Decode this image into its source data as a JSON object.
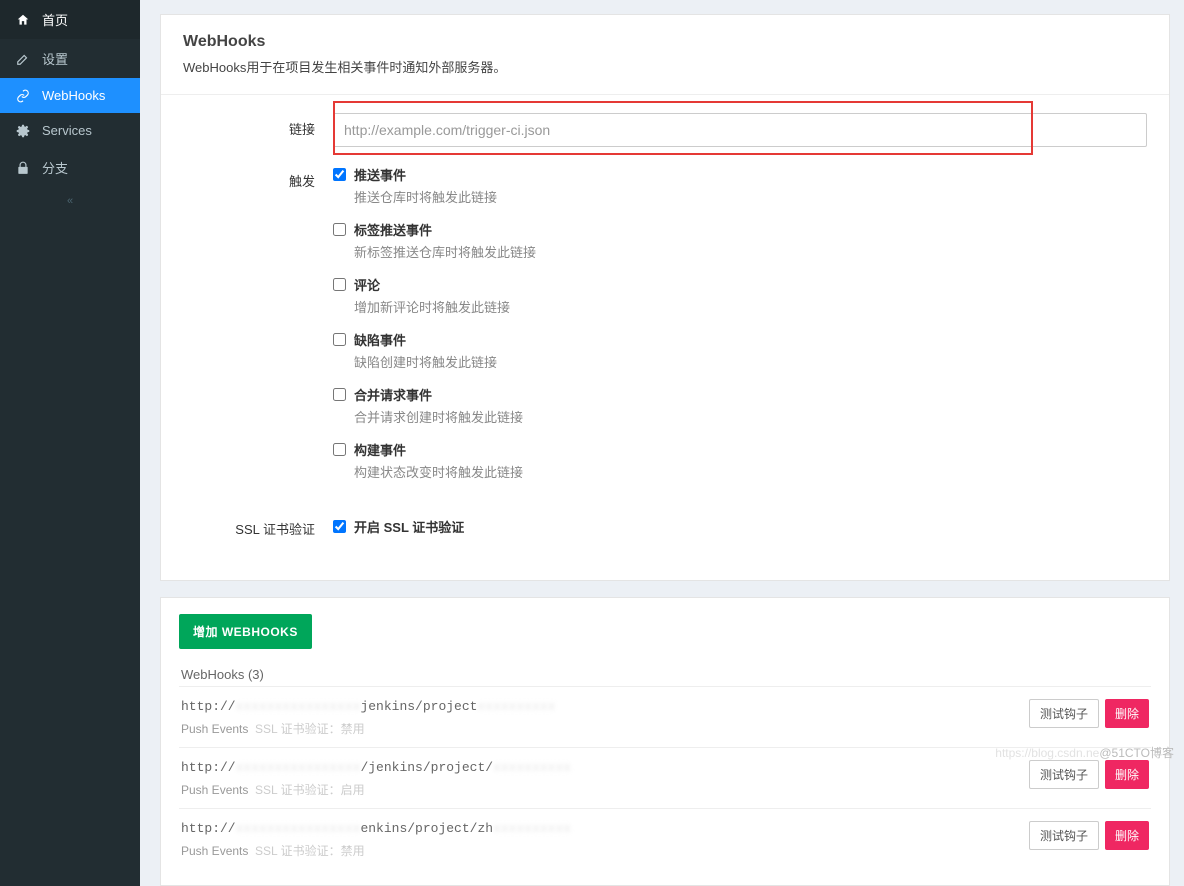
{
  "sidebar": {
    "items": [
      {
        "icon": "home",
        "label": "首页"
      },
      {
        "icon": "edit",
        "label": "设置"
      },
      {
        "icon": "link",
        "label": "WebHooks",
        "active": true
      },
      {
        "icon": "cogs",
        "label": "Services"
      },
      {
        "icon": "lock",
        "label": "分支"
      }
    ]
  },
  "page": {
    "title": "WebHooks",
    "desc_prefix": "WebHooks",
    "desc_rest": "用于在项目发生相关事件时通知外部服务器。"
  },
  "form": {
    "url_label": "链接",
    "url_placeholder": "http://example.com/trigger-ci.json",
    "trigger_label": "触发",
    "triggers": [
      {
        "title": "推送事件",
        "desc": "推送仓库时将触发此链接",
        "checked": true
      },
      {
        "title": "标签推送事件",
        "desc": "新标签推送仓库时将触发此链接",
        "checked": false
      },
      {
        "title": "评论",
        "desc": "增加新评论时将触发此链接",
        "checked": false
      },
      {
        "title": "缺陷事件",
        "desc": "缺陷创建时将触发此链接",
        "checked": false
      },
      {
        "title": "合并请求事件",
        "desc": "合并请求创建时将触发此链接",
        "checked": false
      },
      {
        "title": "构建事件",
        "desc": "构建状态改变时将触发此链接",
        "checked": false
      }
    ],
    "ssl_label": "SSL 证书验证",
    "ssl_checkbox_label": "开启 SSL 证书验证",
    "ssl_checked": true
  },
  "hooks": {
    "add_button": "增加 WEBHOOKS",
    "count_label": "WebHooks (3)",
    "test_button": "测试钩子",
    "delete_button": "删除",
    "items": [
      {
        "url_prefix": "http://",
        "url_mid": "jenkins/project",
        "meta_events": "Push Events",
        "meta_ssl": "SSL 证书验证：禁用"
      },
      {
        "url_prefix": "http://",
        "url_mid": "/jenkins/project/",
        "meta_events": "Push Events",
        "meta_ssl": "SSL 证书验证：启用"
      },
      {
        "url_prefix": "http://",
        "url_mid": "enkins/project/zh",
        "meta_events": "Push Events",
        "meta_ssl": "SSL 证书验证：禁用"
      }
    ]
  },
  "watermark": {
    "left": "https://blog.csdn.ne",
    "right": "@51CTO博客"
  }
}
